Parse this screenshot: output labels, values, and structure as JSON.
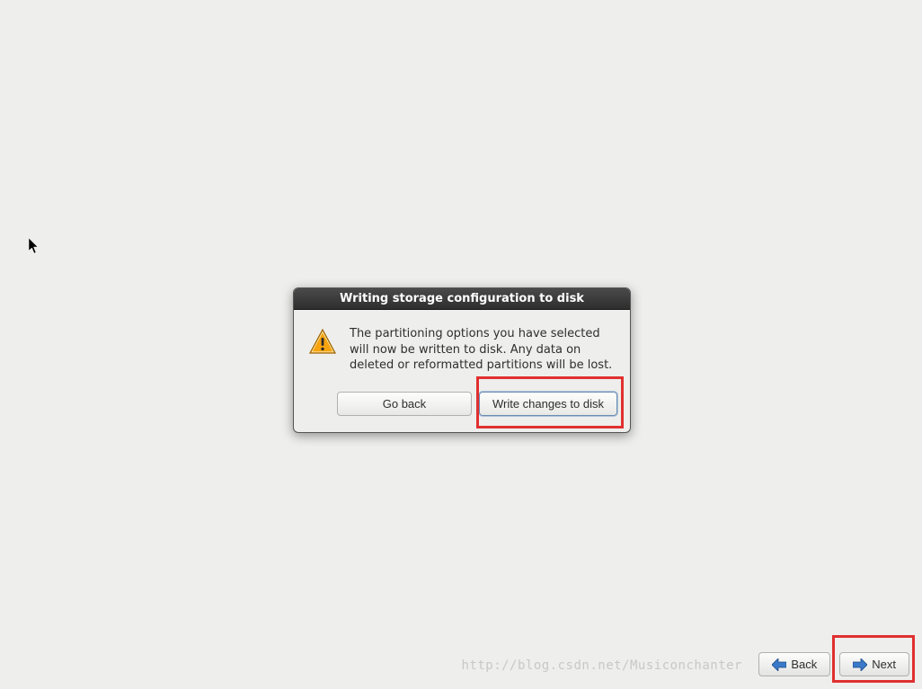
{
  "dialog": {
    "title": "Writing storage configuration to disk",
    "message": "The partitioning options you have selected will now be written to disk.  Any data on deleted or reformatted partitions will be lost.",
    "go_back_label": "Go back",
    "write_label": "Write changes to disk"
  },
  "footer": {
    "back_label": "Back",
    "next_label": "Next"
  },
  "watermark": "http://blog.csdn.net/Musiconchanter"
}
